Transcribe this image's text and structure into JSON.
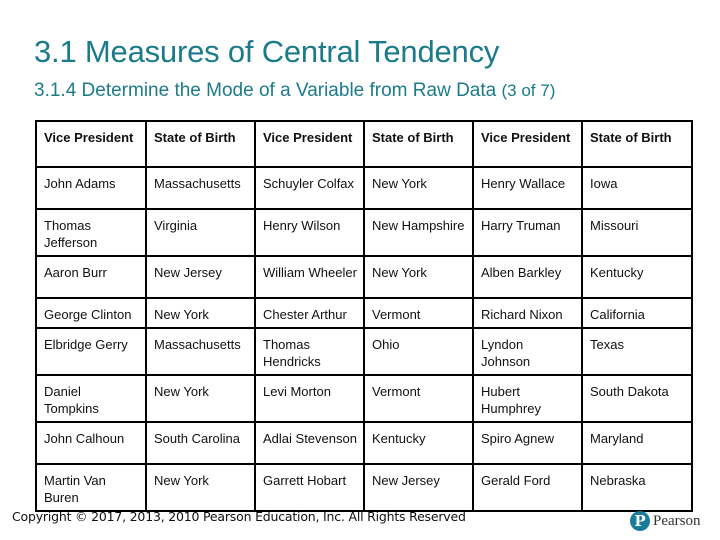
{
  "header": {
    "title": "3.1 Measures of Central Tendency",
    "subtitle": "3.1.4 Determine the Mode of a Variable from Raw Data",
    "part": "(3 of 7)"
  },
  "table": {
    "headers": [
      "Vice President",
      "State of Birth",
      "Vice President",
      "State of Birth",
      "Vice President",
      "State of Birth"
    ],
    "rows": [
      [
        "John Adams",
        "Massachusetts",
        "Schuyler Colfax",
        "New York",
        "Henry Wallace",
        "Iowa"
      ],
      [
        "Thomas Jefferson",
        "Virginia",
        "Henry Wilson",
        "New Hampshire",
        "Harry Truman",
        "Missouri"
      ],
      [
        "Aaron Burr",
        "New Jersey",
        "William Wheeler",
        "New York",
        "Alben Barkley",
        "Kentucky"
      ],
      [
        "George Clinton",
        "New York",
        "Chester Arthur",
        "Vermont",
        "Richard Nixon",
        "California"
      ],
      [
        "Elbridge Gerry",
        "Massachusetts",
        "Thomas Hendricks",
        "Ohio",
        "Lyndon Johnson",
        "Texas"
      ],
      [
        "Daniel Tompkins",
        "New York",
        "Levi Morton",
        "Vermont",
        "Hubert Humphrey",
        "South Dakota"
      ],
      [
        "John Calhoun",
        "South Carolina",
        "Adlai Stevenson",
        "Kentucky",
        "Spiro Agnew",
        "Maryland"
      ],
      [
        "Martin Van Buren",
        "New York",
        "Garrett Hobart",
        "New Jersey",
        "Gerald Ford",
        "Nebraska"
      ]
    ]
  },
  "footer": {
    "copyright": "Copyright © 2017, 2013, 2010 Pearson Education, Inc. All Rights Reserved",
    "logo_mark": "P",
    "logo_text": "Pearson",
    "brand_color": "#1a7c9b"
  },
  "colors": {
    "title": "#1b7b8b"
  }
}
